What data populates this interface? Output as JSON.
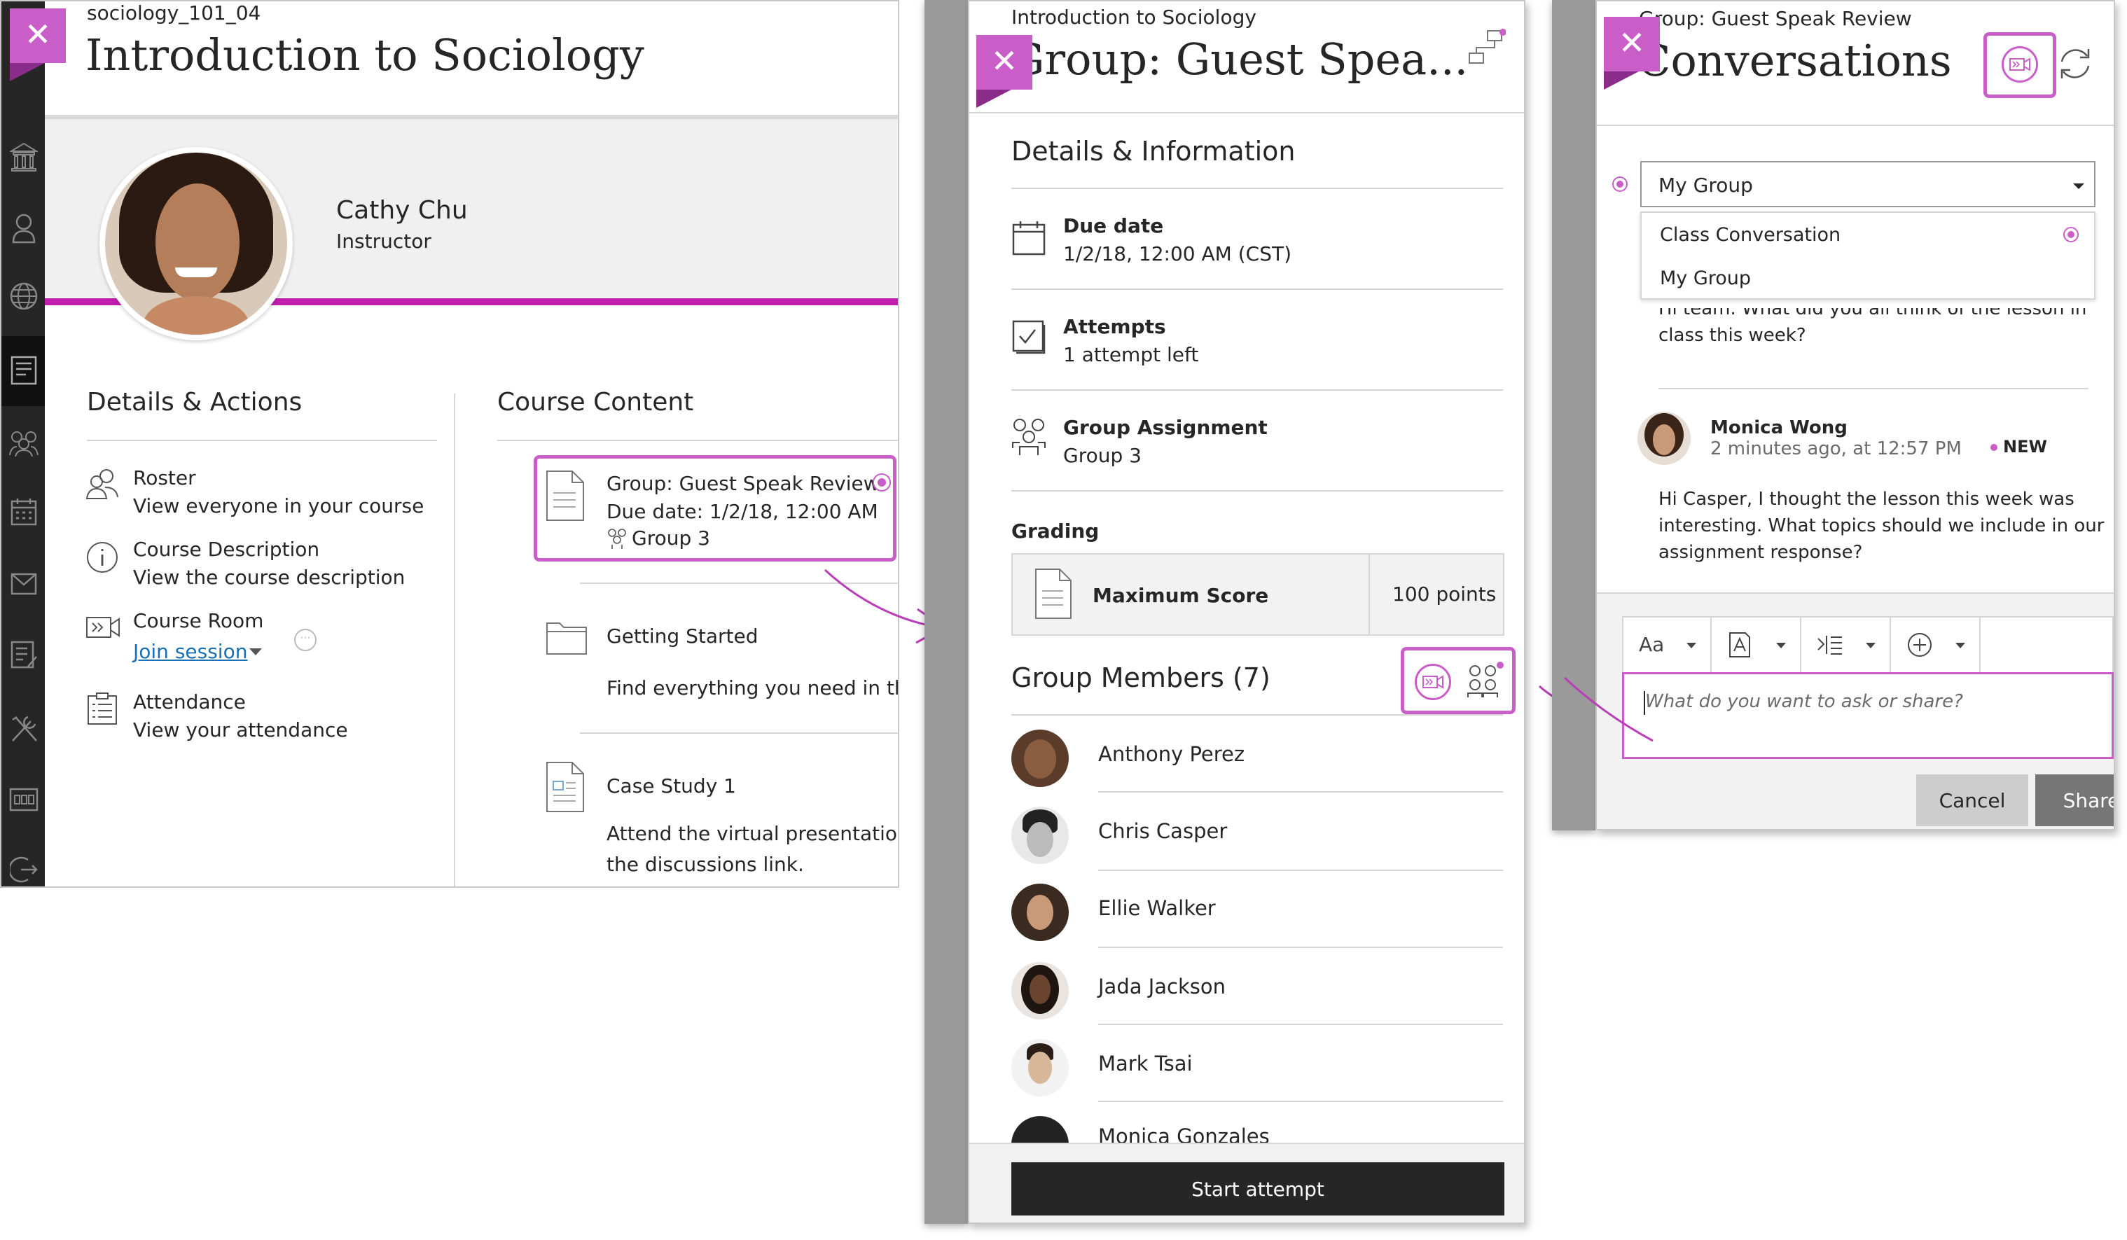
{
  "colors": {
    "accent": "#c95ec9",
    "accent_dark": "#a50ea5",
    "nav_bg": "#262626",
    "start_btn": "#262626",
    "share_btn": "#767676",
    "cancel_btn": "#cdcdcd"
  },
  "left_panel": {
    "course_id": "sociology_101_04",
    "title": "Introduction to Sociology",
    "instructor": {
      "name": "Cathy Chu",
      "role": "Instructor"
    },
    "details_heading": "Details & Actions",
    "details": [
      {
        "icon": "roster-icon",
        "title": "Roster",
        "sub": "View everyone in your course"
      },
      {
        "icon": "info-icon",
        "title": "Course Description",
        "sub": "View the course description"
      },
      {
        "icon": "video-icon",
        "title": "Course Room",
        "sub": "Join session"
      },
      {
        "icon": "attendance-icon",
        "title": "Attendance",
        "sub": "View your attendance"
      }
    ],
    "content_heading": "Course Content",
    "content": [
      {
        "icon": "document-icon",
        "title": "Group: Guest Speak Review",
        "line1": "Due date: 1/2/18, 12:00 AM",
        "line2": "Group 3"
      },
      {
        "icon": "folder-icon",
        "title": "Getting Started",
        "line1": "Find everything you need in the"
      },
      {
        "icon": "page-icon",
        "title": "Case Study 1",
        "line1": "Attend the virtual presentation a",
        "line2": "the discussions link."
      }
    ],
    "nav_icons": [
      "institution-icon",
      "profile-icon",
      "globe-icon",
      "courses-icon",
      "groups-icon",
      "calendar-icon",
      "messages-icon",
      "grades-icon",
      "tools-icon",
      "cards-icon",
      "signout-icon"
    ]
  },
  "middle_panel": {
    "breadcrumb": "Introduction to Sociology",
    "title": "Group: Guest Spea...",
    "details_heading": "Details & Information",
    "due_label": "Due date",
    "due_value": "1/2/18, 12:00 AM (CST)",
    "attempts_label": "Attempts",
    "attempts_value": "1 attempt left",
    "group_label": "Group Assignment",
    "group_value": "Group 3",
    "grading_heading": "Grading",
    "max_score_label": "Maximum Score",
    "max_score_value": "100 points",
    "members_heading": "Group Members (7)",
    "members": [
      "Anthony Perez",
      "Chris Casper",
      "Ellie Walker",
      "Jada Jackson",
      "Mark Tsai",
      "Monica Gonzales"
    ],
    "start_button": "Start attempt"
  },
  "right_panel": {
    "breadcrumb": "Group: Guest Speak Review",
    "title": "Conversations",
    "select_value": "My Group",
    "options": [
      "Class Conversation",
      "My Group"
    ],
    "prev_message": "Hi team. What did you all think of the lesson in",
    "prev_message_2": "class this week?",
    "author": "Monica Wong",
    "time": "2 minutes ago, at 12:57 PM",
    "new_badge": "NEW",
    "message": [
      "Hi Casper, I thought the lesson this week was",
      "interesting. What topics should we include in our",
      "assignment response?"
    ],
    "input_placeholder": "What do you want to ask or share?",
    "cancel_button": "Cancel",
    "share_button": "Share"
  }
}
